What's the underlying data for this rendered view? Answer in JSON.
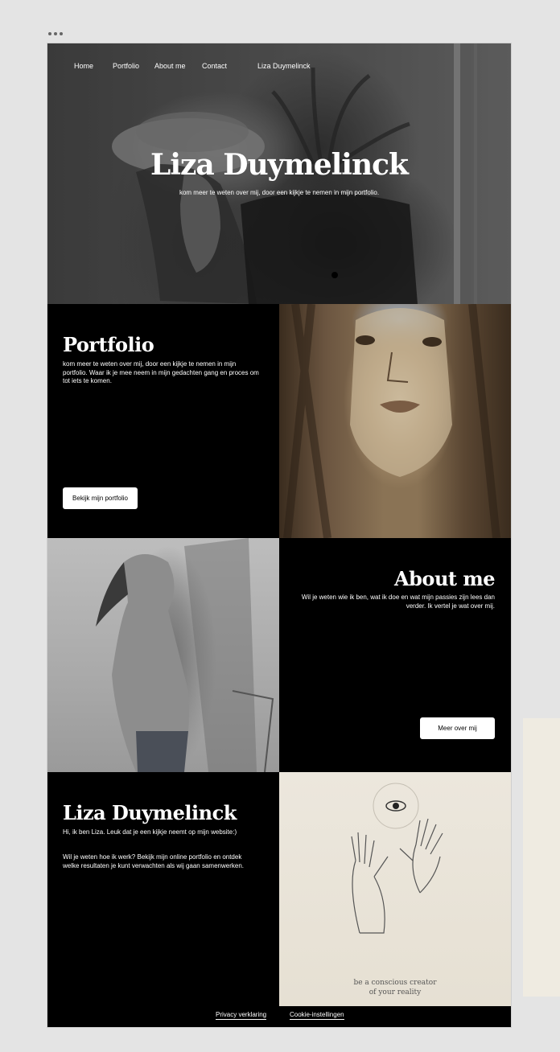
{
  "nav": {
    "home": "Home",
    "portfolio": "Portfolio",
    "about": "About me",
    "contact": "Contact",
    "brand": "Liza Duymelinck"
  },
  "hero": {
    "title": "Liza Duymelinck",
    "subtitle": "kom meer te weten over mij, door een kijkje te nemen in mijn portfolio."
  },
  "portfolio": {
    "title": "Portfolio",
    "text": "kom meer te weten over mij, door een kijkje te nemen in mijn portfolio. Waar ik je mee neem in mijn gedachten gang en proces om tot iets te komen.",
    "button": "Bekijk mijn portfolio"
  },
  "about": {
    "title": "About me",
    "text": "Wil je weten wie ik ben, wat ik doe en wat mijn passies zijn lees dan verder. Ik vertel je wat over mij.",
    "button": "Meer over mij"
  },
  "intro": {
    "title": "Liza Duymelinck",
    "text1": "Hi, ik ben Liza. Leuk dat je een kijkje neemt op mijn website:)",
    "text2": "Wil je weten hoe ik werk? Bekijk mijn online portfolio en ontdek welke resultaten je kunt verwachten als wij gaan samenwerken."
  },
  "artwork": {
    "caption_line1": "be a conscious creator",
    "caption_line2": "of your reality"
  },
  "footer": {
    "privacy": "Privacy verklaring",
    "cookies": "Cookie-instellingen"
  }
}
